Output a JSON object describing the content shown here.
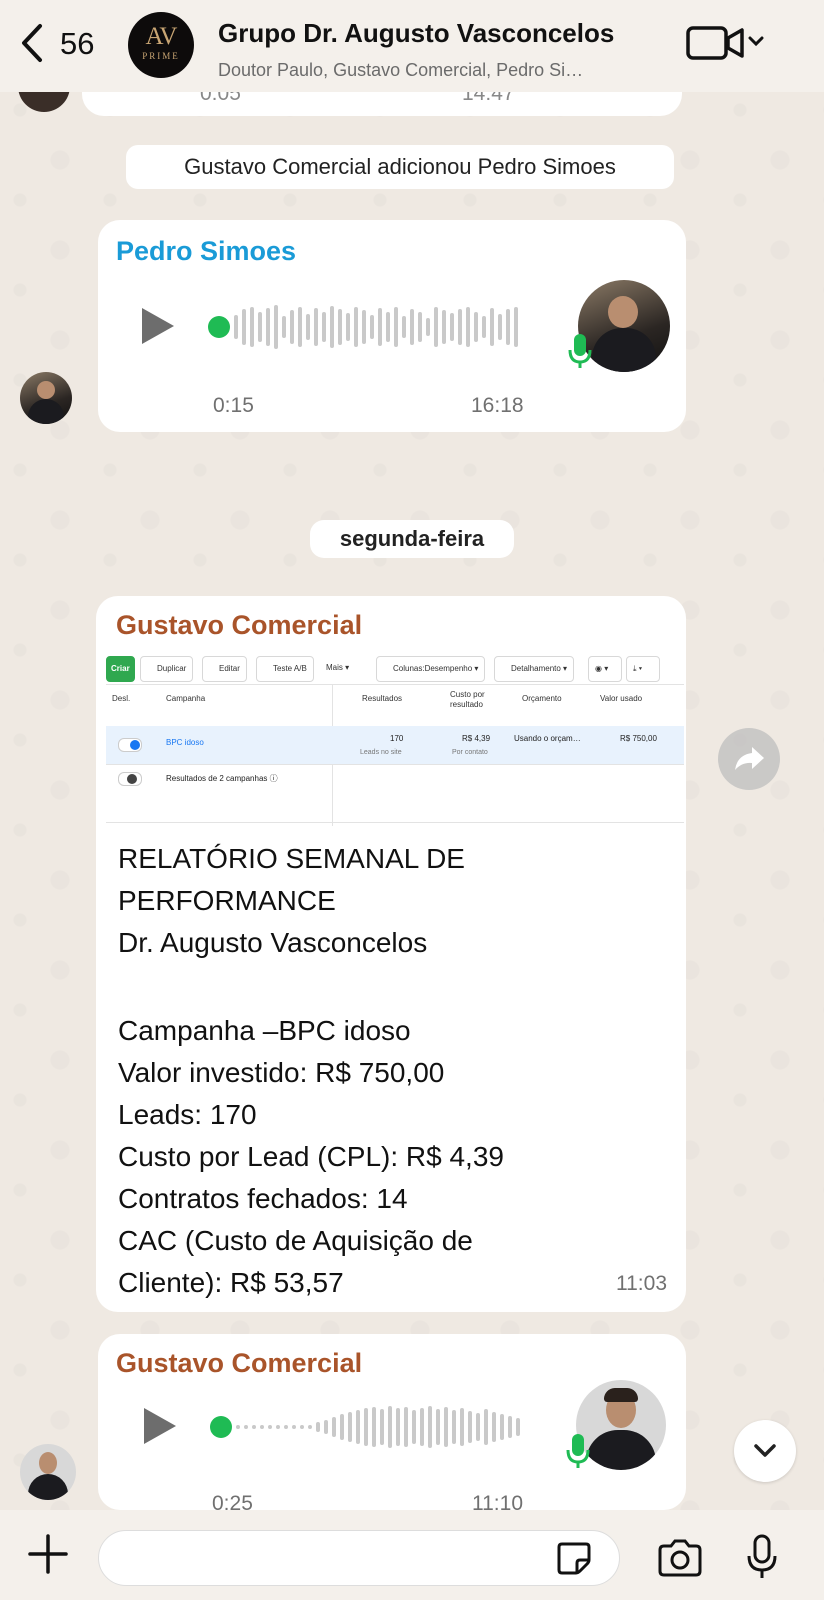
{
  "header": {
    "back_count": "56",
    "group_avatar_text": "AV",
    "group_avatar_sub": "PRIME",
    "title": "Grupo Dr. Augusto Vasconcelos",
    "subtitle": "Doutor Paulo, Gustavo Comercial, Pedro Si…"
  },
  "messages": {
    "partial_top": {
      "duration": "0:05",
      "time": "14:47"
    },
    "system_added": "Gustavo Comercial adicionou Pedro Simoes",
    "voice1": {
      "sender": "Pedro Simoes",
      "sender_color": "#1a9bd7",
      "duration": "0:15",
      "time": "16:18"
    },
    "date_separator": "segunda-feira",
    "report_msg": {
      "sender": "Gustavo Comercial",
      "sender_color": "#a9542a",
      "time": "11:03",
      "screenshot": {
        "buttons": [
          "Criar",
          "Duplicar",
          "Editar",
          "Teste A/B",
          "Mais ▾",
          "Colunas:Desempenho ▾",
          "Detalhamento ▾"
        ],
        "columns": [
          "Desl.",
          "Campanha",
          "Resultados",
          "Custo por resultado",
          "Orçamento",
          "Valor usado"
        ],
        "row1": {
          "campaign": "BPC idoso",
          "results": "170",
          "results_sub": "Leads no site",
          "cost": "R$ 4,39",
          "cost_sub": "Por contato",
          "budget": "Usando o orçam…",
          "spent": "R$ 750,00"
        },
        "row2": {
          "campaign": "Resultados de 2 campanhas ⓘ"
        }
      },
      "lines": [
        "RELATÓRIO SEMANAL DE",
        "PERFORMANCE",
        "Dr. Augusto Vasconcelos",
        "",
        "Campanha –BPC idoso",
        "Valor investido: R$ 750,00",
        "Leads: 170",
        "Custo por Lead (CPL): R$ 4,39",
        "Contratos fechados: 14",
        "CAC (Custo de Aquisição de",
        "Cliente): R$ 53,57"
      ]
    },
    "voice2": {
      "sender": "Gustavo Comercial",
      "sender_color": "#a9542a",
      "duration": "0:25",
      "time": "11:10"
    }
  },
  "icons": [
    "back-chevron-icon",
    "video-call-icon",
    "chevron-down-icon",
    "play-icon",
    "mic-icon",
    "forward-icon",
    "plus-icon",
    "sticker-icon",
    "camera-icon"
  ]
}
